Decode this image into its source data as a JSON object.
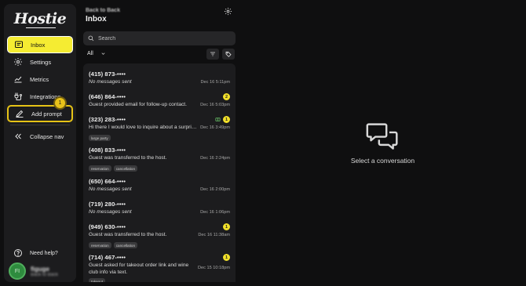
{
  "brand": {
    "logo_text": "Hostie"
  },
  "sidebar": {
    "items": [
      {
        "label": "Inbox",
        "icon": "inbox-icon"
      },
      {
        "label": "Settings",
        "icon": "gear-icon"
      },
      {
        "label": "Metrics",
        "icon": "chart-icon"
      },
      {
        "label": "Integrations",
        "icon": "plug-icon"
      },
      {
        "label": "Add prompt",
        "icon": "pen-icon"
      }
    ],
    "collapse_label": "Collapse nav",
    "tour_step": "1",
    "help_label": "Need help?",
    "user": {
      "initials": "FI",
      "name": "figuge",
      "restaurant": "Back to Back"
    }
  },
  "header": {
    "breadcrumb": "Back to Back",
    "title": "Inbox"
  },
  "search": {
    "placeholder": "Search"
  },
  "filter": {
    "selected": "All"
  },
  "conversations": [
    {
      "phone": "(415) 873-••••",
      "preview": "No messages sent",
      "italic": true,
      "time": "Dec 16 5:11pm",
      "count": "",
      "tags": []
    },
    {
      "phone": "(646) 864-••••",
      "preview": "Guest provided email for follow-up contact.",
      "italic": false,
      "time": "Dec 16 5:03pm",
      "count": "2",
      "tags": []
    },
    {
      "phone": "(323) 283-••••",
      "preview": "Hi there I would love to inquire about a surprise party",
      "italic": false,
      "time": "Dec 16 3:49pm",
      "count": "1",
      "tags": [
        "large party"
      ]
    },
    {
      "phone": "(408) 833-••••",
      "preview": "Guest was transferred to the host.",
      "italic": false,
      "time": "Dec 16 2:24pm",
      "count": "",
      "tags": [
        "reservation",
        "cancellation"
      ]
    },
    {
      "phone": "(650) 664-••••",
      "preview": "No messages sent",
      "italic": true,
      "time": "Dec 16 2:00pm",
      "count": "",
      "tags": []
    },
    {
      "phone": "(719) 280-••••",
      "preview": "No messages sent",
      "italic": true,
      "time": "Dec 16 1:06pm",
      "count": "",
      "tags": []
    },
    {
      "phone": "(949) 630-••••",
      "preview": "Guest was transferred to the host.",
      "italic": false,
      "time": "Dec 16 11:38am",
      "count": "1",
      "tags": [
        "reservation",
        "cancellation"
      ]
    },
    {
      "phone": "(714) 467-••••",
      "preview": "Guest asked for takeout order link and wine club info via text.",
      "italic": false,
      "time": "Dec 15 10:18pm",
      "count": "1",
      "tags": [
        "takeout"
      ]
    }
  ],
  "empty_state": {
    "text": "Select a conversation",
    "icon": "chat-bubbles-icon"
  },
  "colors": {
    "accent": "#f5ec32",
    "highlight_border": "#e6c316",
    "avatar": "#2e8b3e",
    "background": "#0f0f10",
    "panel": "#1c1c1e"
  }
}
